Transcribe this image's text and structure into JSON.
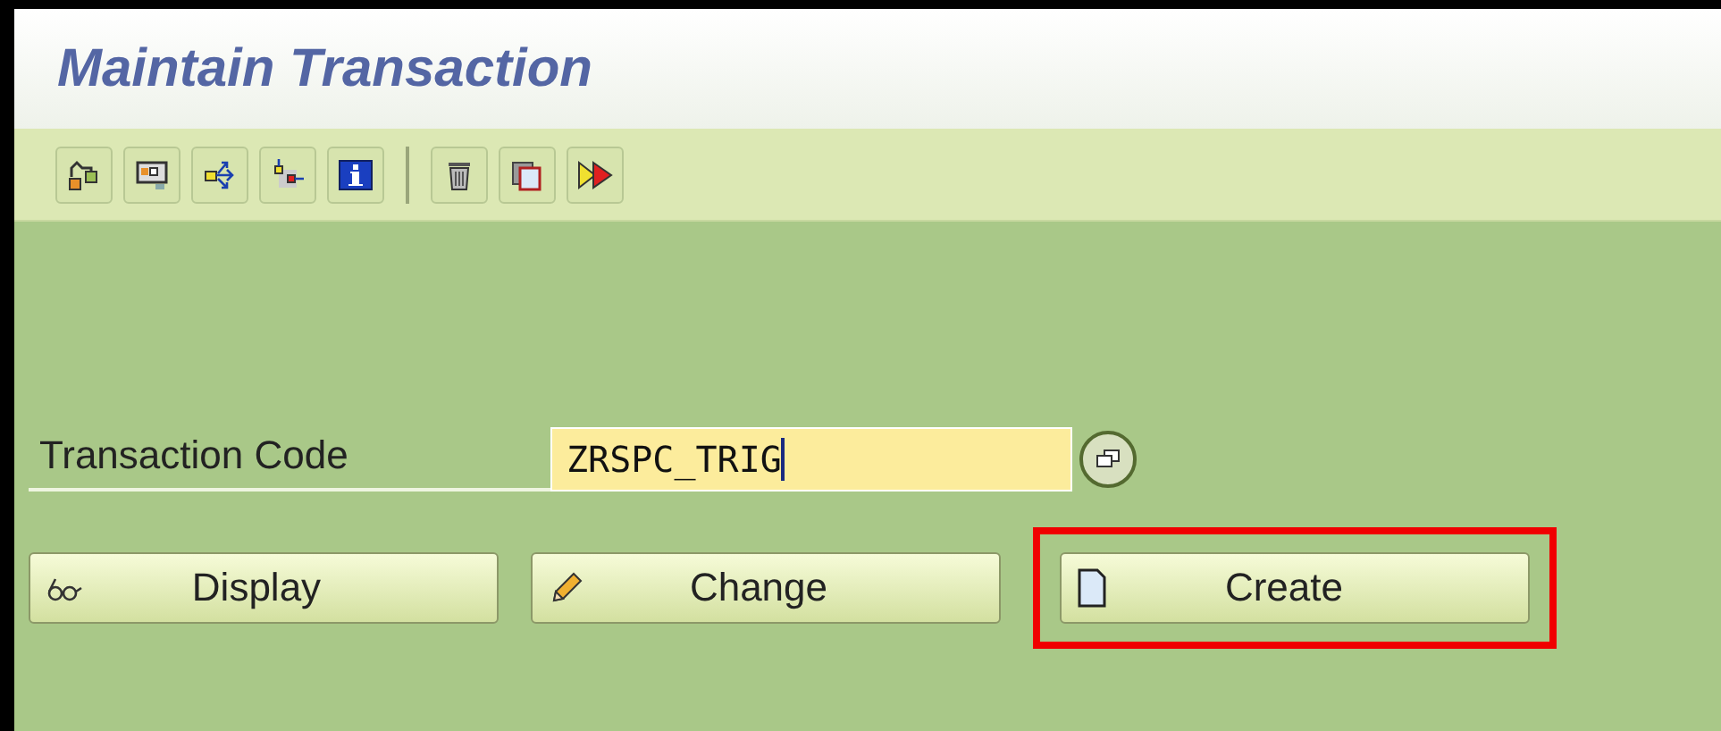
{
  "window": {
    "title": "Maintain Transaction"
  },
  "form": {
    "label": "Transaction Code",
    "value": "ZRSPC_TRIG",
    "focused": true
  },
  "buttons": [
    {
      "kind": "display",
      "label": "Display",
      "highlighted": false
    },
    {
      "kind": "change",
      "label": "Change",
      "highlighted": false
    },
    {
      "kind": "create",
      "label": "Create",
      "highlighted": true
    }
  ]
}
